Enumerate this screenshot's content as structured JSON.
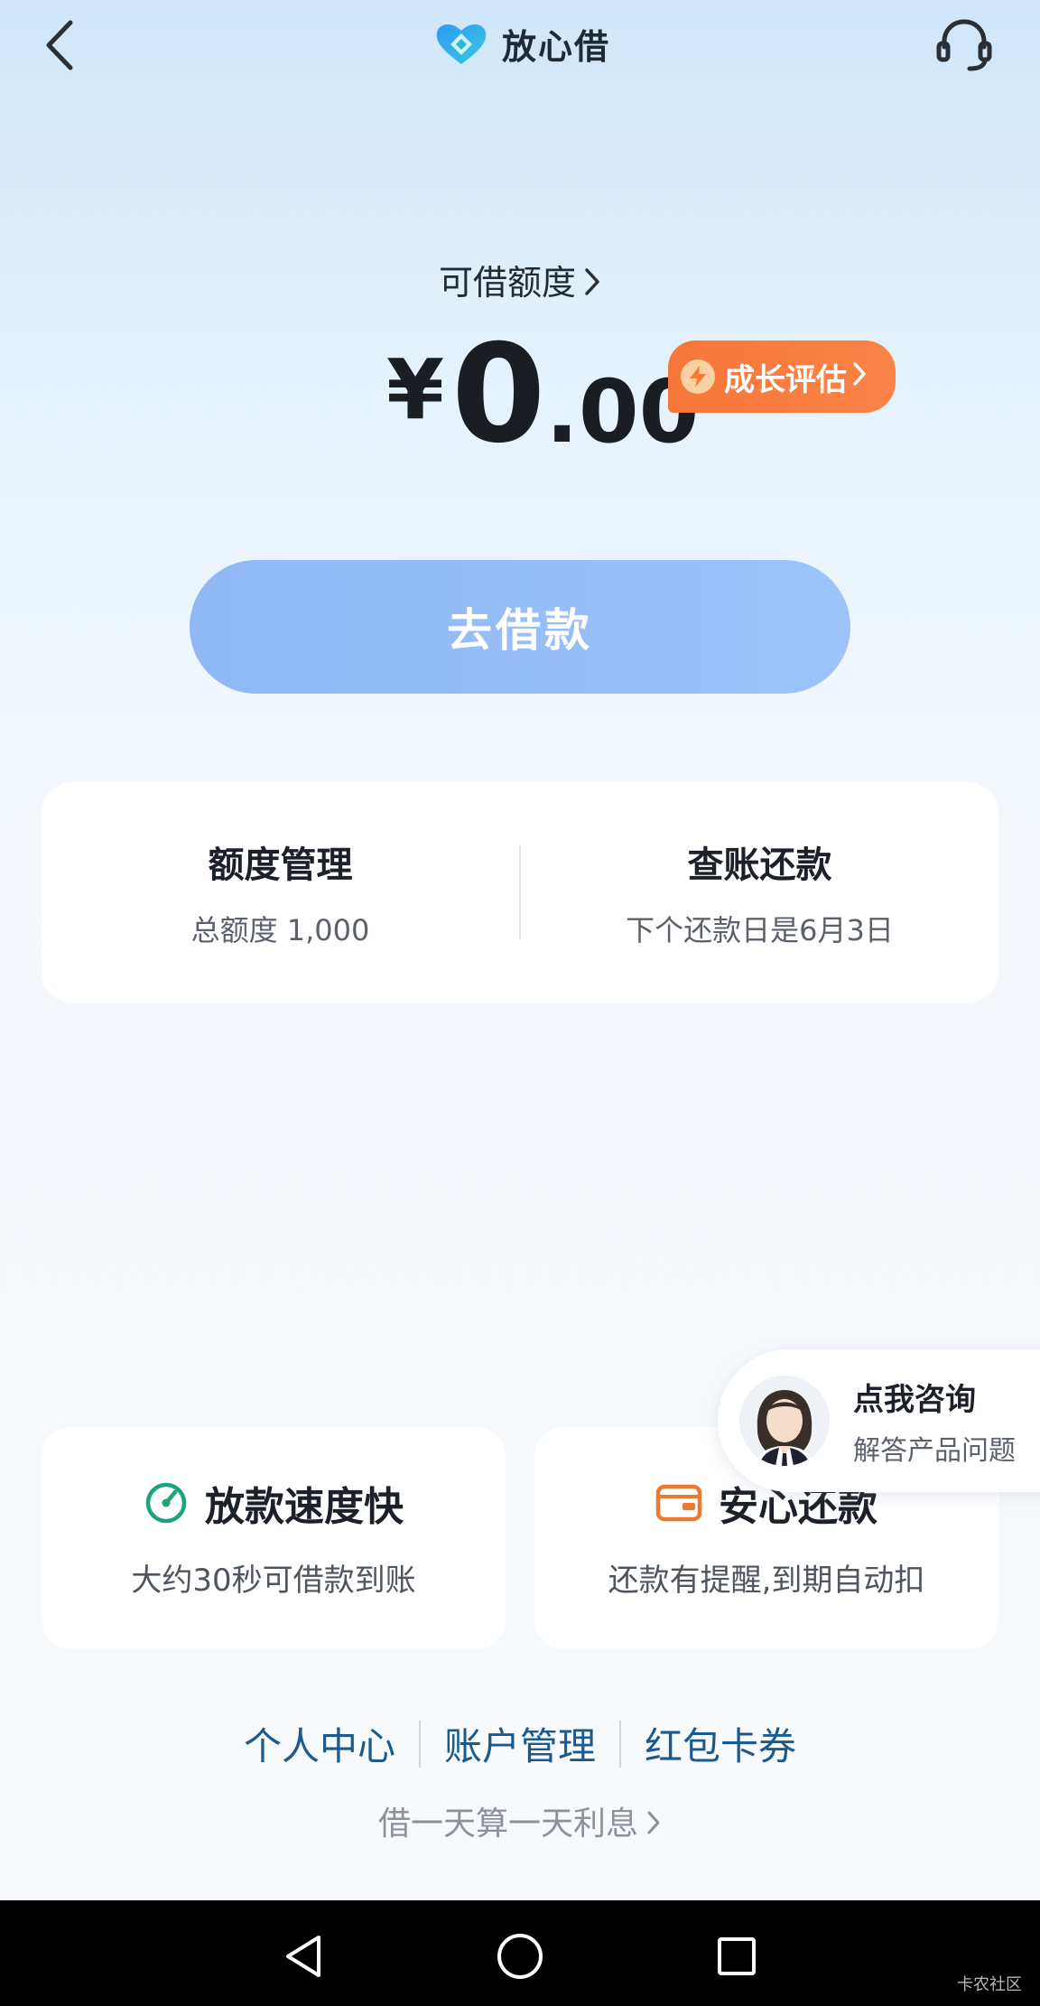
{
  "header": {
    "brand_name": "放心借",
    "back_icon": "chevron-left-icon",
    "service_icon": "headset-icon"
  },
  "credit": {
    "label": "可借额度",
    "currency_symbol": "¥",
    "amount_integer": "0",
    "amount_decimal": ".00",
    "growth_button": "成长评估"
  },
  "borrow_button": "去借款",
  "quota": {
    "manage_title": "额度管理",
    "manage_sub": "总额度 1,000",
    "bill_title": "查账还款",
    "bill_sub": "下个还款日是6月3日"
  },
  "consult": {
    "title": "点我咨询",
    "subtitle": "解答产品问题"
  },
  "features": [
    {
      "title": "放款速度快",
      "desc": "大约30秒可借款到账",
      "icon": "speedometer-icon"
    },
    {
      "title": "安心还款",
      "desc": "还款有提醒,到期自动扣",
      "icon": "wallet-icon"
    }
  ],
  "links": [
    "个人中心",
    "账户管理",
    "红包卡券"
  ],
  "interest_note": "借一天算一天利息",
  "watermark": "卡农社区",
  "colors": {
    "accent_orange": "#f7773a",
    "borrow_button": "#96bef7",
    "link_blue": "#1b5a8f",
    "feature_green": "#1ea37f",
    "feature_orange": "#ec7a2e"
  }
}
